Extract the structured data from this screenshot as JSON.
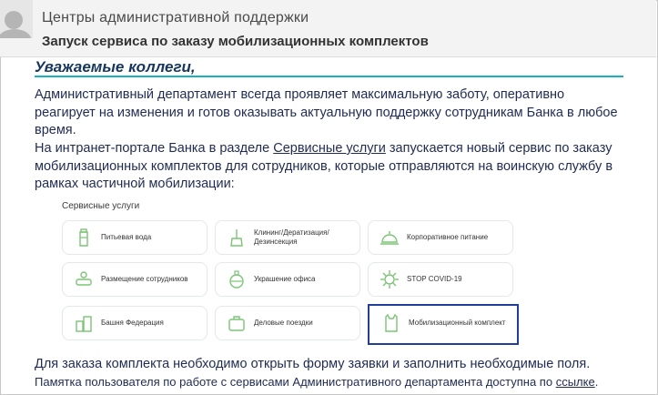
{
  "header": {
    "sender": "Центры  административной поддержки",
    "subject": "Запуск сервиса по заказу мобилизационных комплектов"
  },
  "body": {
    "greeting": "Уважаемые коллеги,",
    "para1": "Административный департамент всегда проявляет максимальную заботу, оперативно реагирует на изменения и готов оказывать актуальную поддержку сотрудникам Банка в любое время.",
    "para2_before": "На интранет-портале Банка в разделе ",
    "para2_link": "Сервисные услуги",
    "para2_after": " запускается новый сервис по заказу мобилизационных комплектов для сотрудников, которые отправляются на воинскую службу в рамках частичной мобилизации:",
    "footer1": "Для заказа комплекта необходимо открыть форму заявки и заполнить необходимые поля.",
    "footer2_before": "Памятка пользователя по работе с сервисами Административного департамента доступна по ",
    "footer2_link": "ссылке",
    "footer2_after": "."
  },
  "services": {
    "title": "Сервисные услуги",
    "items": [
      {
        "label": "Питьевая вода",
        "icon": "water-bottle-icon"
      },
      {
        "label": "Клининг/Дератизация/\nДезинсекция",
        "icon": "cleaning-icon"
      },
      {
        "label": "Корпоративное питание",
        "icon": "food-cloche-icon"
      },
      {
        "label": "Размещение сотрудников",
        "icon": "workplace-icon"
      },
      {
        "label": "Украшение офиса",
        "icon": "ornament-icon"
      },
      {
        "label": "STOP COVID-19",
        "icon": "virus-icon"
      },
      {
        "label": "Башня Федерация",
        "icon": "building-icon"
      },
      {
        "label": "Деловые поездки",
        "icon": "suitcase-icon"
      },
      {
        "label": "Мобилизационный комплект",
        "icon": "vest-icon"
      }
    ]
  },
  "colors": {
    "accent_green": "#7cc576",
    "rule": "#17b0c4",
    "highlight": "#1f3f9a",
    "text_navy": "#1f2b52"
  }
}
